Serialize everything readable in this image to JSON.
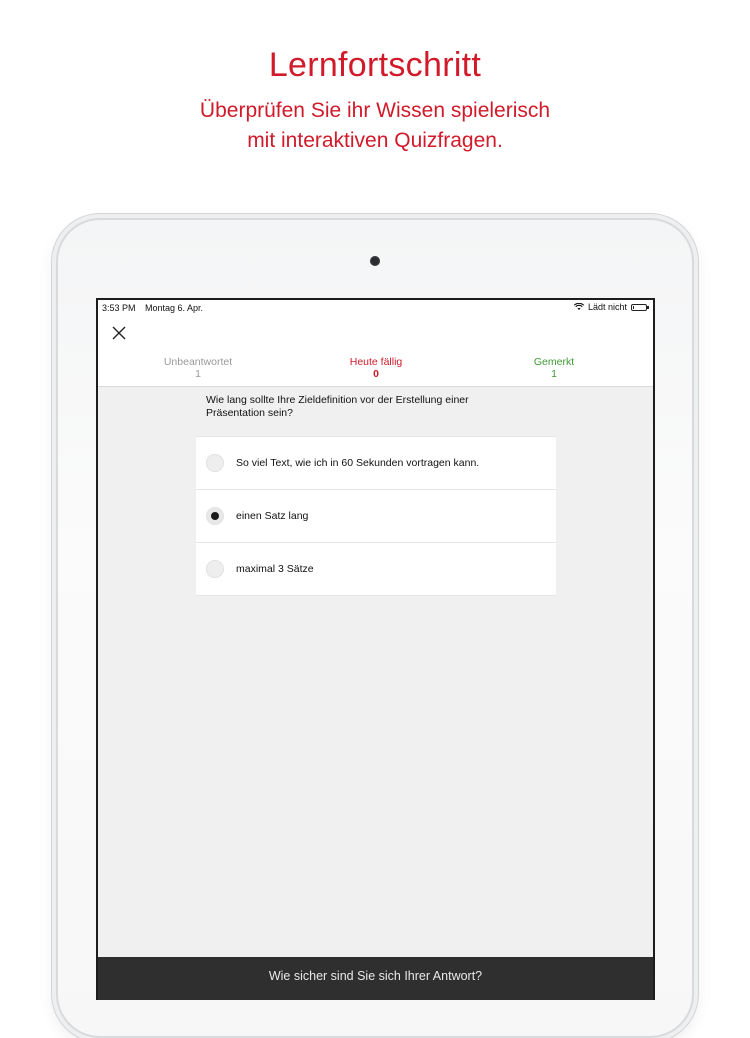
{
  "promo": {
    "title": "Lernfortschritt",
    "subtitle_line1": "Überprüfen Sie ihr Wissen spielerisch",
    "subtitle_line2": "mit interaktiven Quizfragen."
  },
  "statusbar": {
    "time": "3:53 PM",
    "date": "Montag 6. Apr.",
    "charging": "Lädt nicht",
    "battery_level": 0.1
  },
  "tabs": [
    {
      "label": "Unbeantwortet",
      "count": "1",
      "color": "#9a9a9a"
    },
    {
      "label": "Heute fällig",
      "count": "0",
      "color": "#d11a2a"
    },
    {
      "label": "Gemerkt",
      "count": "1",
      "color": "#3f9a35"
    }
  ],
  "quiz": {
    "question": "Wie lang sollte Ihre Zieldefinition vor der Erstellung einer Präsentation sein?",
    "answers": [
      {
        "text": "So viel Text, wie ich in 60 Sekunden vortragen kann.",
        "selected": false
      },
      {
        "text": "einen Satz lang",
        "selected": true
      },
      {
        "text": "maximal 3 Sätze",
        "selected": false
      }
    ]
  },
  "confidence_prompt": "Wie sicher sind Sie sich Ihrer Antwort?",
  "colors": {
    "accent": "#d11a2a",
    "marked": "#3f9a35"
  }
}
